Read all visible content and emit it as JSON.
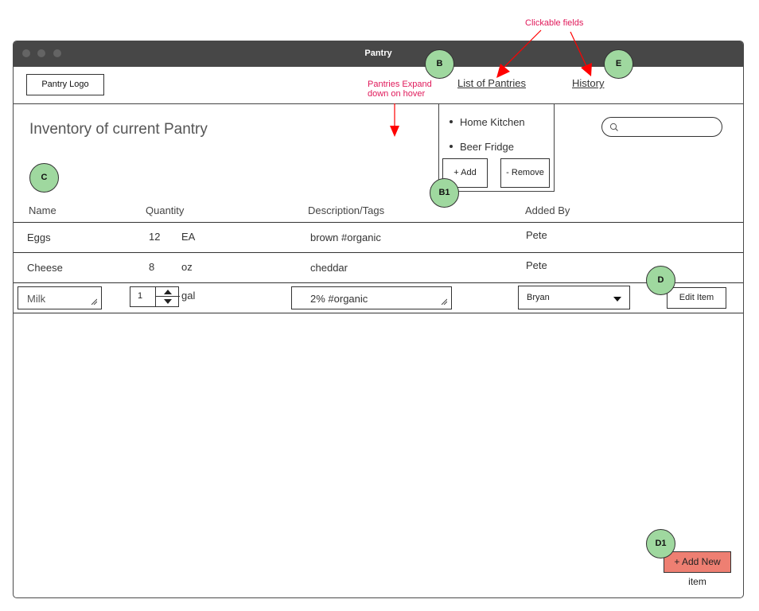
{
  "annotations": {
    "clickable_fields": "Clickable fields",
    "pantries_expand_line1": "Pantries Expand",
    "pantries_expand_line2": "down on hover"
  },
  "window": {
    "title": "Pantry"
  },
  "navbar": {
    "logo_label": "Pantry Logo",
    "list_of_pantries": "List of Pantries",
    "history": "History"
  },
  "page": {
    "title": "Inventory of current Pantry"
  },
  "pantries_dropdown": {
    "items": [
      "Home Kitchen",
      "Beer Fridge"
    ],
    "add_label": "+ Add",
    "remove_label": "- Remove"
  },
  "markers": {
    "b": "B",
    "b1": "B1",
    "c": "C",
    "d": "D",
    "d1": "D1",
    "e": "E"
  },
  "table": {
    "headers": [
      "Name",
      "Quantity",
      "Description/Tags",
      "Added By"
    ],
    "rows": [
      {
        "name": "Eggs",
        "quantity": "12",
        "unit": "EA",
        "description": "brown #organic",
        "added_by": "Pete"
      },
      {
        "name": "Cheese",
        "quantity": "8",
        "unit": "oz",
        "description": "cheddar",
        "added_by": "Pete"
      }
    ],
    "edit_row": {
      "name": "Milk",
      "quantity": "1",
      "unit": "gal",
      "description": "2% #organic",
      "added_by": "Bryan",
      "edit_label": "Edit Item"
    }
  },
  "add_new_label": "+ Add New item",
  "colors": {
    "titlebar": "#474747",
    "marker_fill": "#9fd89f",
    "add_button": "#ee7f72",
    "annotation": "#e0195a",
    "arrow": "#ff0000"
  }
}
